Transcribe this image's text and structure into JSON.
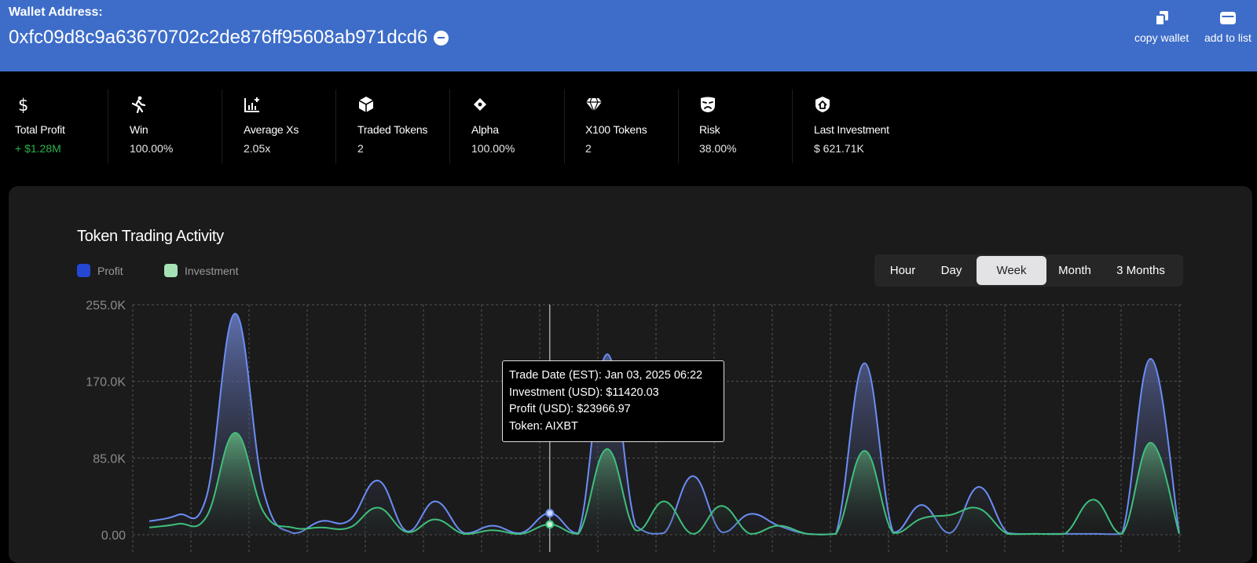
{
  "header": {
    "wallet_label": "Wallet Address:",
    "wallet_address": "0xfc09d8c9a63670702c2de876ff95608ab971dcd6",
    "copy_label": "copy wallet",
    "add_label": "add to list"
  },
  "stats": [
    {
      "icon": "dollar-icon",
      "label": "Total Profit",
      "value": "+ $1.28M",
      "color": "#28b34b"
    },
    {
      "icon": "runner-icon",
      "label": "Win",
      "value": "100.00%"
    },
    {
      "icon": "chart-plus-icon",
      "label": "Average Xs",
      "value": "2.05x"
    },
    {
      "icon": "cube-icon",
      "label": "Traded Tokens",
      "value": "2"
    },
    {
      "icon": "diamond-dot-icon",
      "label": "Alpha",
      "value": "100.00%"
    },
    {
      "icon": "gem-icon",
      "label": "X100 Tokens",
      "value": "2"
    },
    {
      "icon": "mask-icon",
      "label": "Risk",
      "value": "38.00%"
    },
    {
      "icon": "shield-home-icon",
      "label": "Last Investment",
      "value": "$ 621.71K"
    }
  ],
  "chart": {
    "title": "Token Trading Activity",
    "legend": [
      {
        "name": "Profit",
        "color": "#2447d4"
      },
      {
        "name": "Investment",
        "color": "#a5e3b7"
      }
    ],
    "periods": [
      "Hour",
      "Day",
      "Week",
      "Month",
      "3 Months"
    ],
    "active_period": "Week",
    "tooltip": {
      "line1": "Trade Date (EST): Jan 03, 2025 06:22",
      "line2": "Investment (USD): $11420.03",
      "line3": "Profit (USD): $23966.97",
      "line4": "Token: AIXBT"
    }
  },
  "chart_data": {
    "type": "area",
    "title": "Token Trading Activity",
    "xlabel": "",
    "ylabel": "",
    "y_ticks": [
      "255.0K",
      "170.0K",
      "85.0K",
      "0.00"
    ],
    "ylim": [
      0,
      255000
    ],
    "grid": true,
    "legend_position": "top-left",
    "series": [
      {
        "name": "Profit",
        "color": "#6b8ef5",
        "values": [
          15000,
          22000,
          42000,
          245000,
          48000,
          2000,
          15000,
          16000,
          60000,
          4000,
          37000,
          2000,
          10000,
          2000,
          23966.97,
          2000,
          200000,
          10000,
          2000,
          65000,
          3000,
          23000,
          10000,
          1000,
          1000,
          190000,
          3000,
          33000,
          2000,
          53000,
          2000,
          1000,
          1000,
          1000,
          1000,
          195000,
          2000
        ]
      },
      {
        "name": "Investment",
        "color": "#3fbf7c",
        "values": [
          8000,
          12000,
          20000,
          113000,
          25000,
          8000,
          8000,
          8000,
          30000,
          3000,
          17000,
          1000,
          5000,
          1000,
          11420.03,
          1000,
          95000,
          5000,
          37000,
          1000,
          32000,
          1000,
          10000,
          1000,
          1000,
          93000,
          2000,
          18000,
          22000,
          29000,
          1000,
          1000,
          1000,
          39000,
          1000,
          102000,
          1000
        ]
      }
    ]
  }
}
